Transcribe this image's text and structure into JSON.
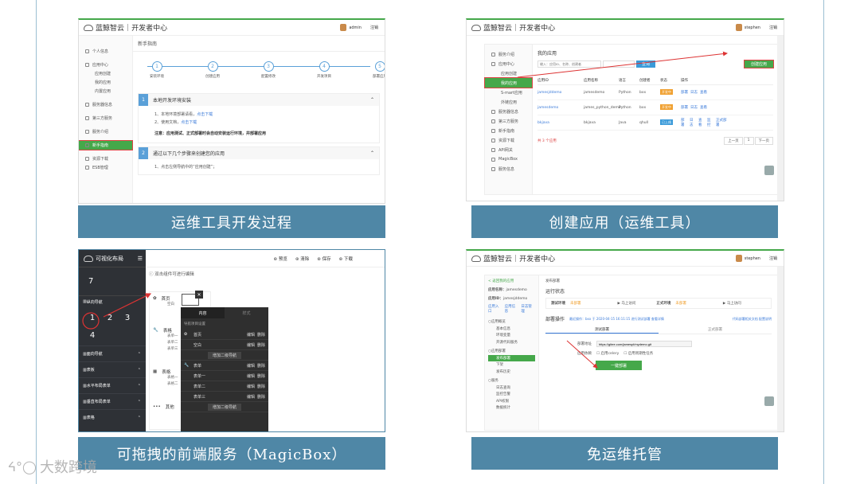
{
  "captions": [
    "运维工具开发过程",
    "创建应用（运维工具）",
    "可拖拽的前端服务（MagicBox）",
    "免运维托管"
  ],
  "watermark": "大数跨境",
  "common": {
    "brand": "蓝鲸智云",
    "center": "开发者中心",
    "logout": "注销"
  },
  "p1": {
    "user": "admin",
    "breadcrumb": "新手指南",
    "sidebar": [
      "个人信息",
      "应用中心",
      "应用创建",
      "我的应用",
      "内置应用",
      "服务器信息",
      "第三方服务",
      "服务介绍",
      "新手指南",
      "资源下载",
      "ESB管理"
    ],
    "steps": [
      {
        "n": "1",
        "label": "安装环境"
      },
      {
        "n": "2",
        "label": "创建应用"
      },
      {
        "n": "3",
        "label": "配置修改"
      },
      {
        "n": "4",
        "label": "开发项目"
      },
      {
        "n": "5",
        "label": "部署应用"
      }
    ],
    "sec1_title": "本地开发环境安装",
    "sec1_lines": [
      "1、本地环境部署请看，",
      "2、使用文档，"
    ],
    "sec1_links": [
      "点击下载",
      "点击下载"
    ],
    "sec1_note": "注意：应用测试、正式部署时会自动安装运行环境，并部署应用",
    "sec2_title": "通过以下几个步骤来创建您的应用",
    "sec2_line": "1、点击左侧导航中的“应用创建”；"
  },
  "p2": {
    "user": "stephen",
    "title": "我的应用",
    "search_placeholder": "输入：应用ID、名称、创建者",
    "search_btn": "查询",
    "create_btn": "创建应用",
    "sidebar": [
      "服务介绍",
      "应用中心",
      "应用创建",
      "我的应用",
      "S-mart应用",
      "外链应用",
      "服务器信息",
      "第三方服务",
      "新手指南",
      "资源下载",
      "API网关",
      "MagicBox",
      "服务信息"
    ],
    "columns": [
      "应用ID",
      "应用名称",
      "语言",
      "创建者",
      "状态",
      "操作"
    ],
    "rows": [
      {
        "id": "jamesjddemo",
        "name": "jamesdemo",
        "lang": "Python",
        "creator": "bxx",
        "status": "开发中",
        "ops": [
          "部署",
          "日志",
          "查看"
        ]
      },
      {
        "id": "jamesdemo",
        "name": "james_python_demo",
        "lang": "Python",
        "creator": "bxx",
        "status": "开发中",
        "ops": [
          "部署",
          "日志",
          "查看"
        ]
      },
      {
        "id": "bkjava",
        "name": "bkjava",
        "lang": "Java",
        "creator": "qhull",
        "status": "已上线",
        "ops": [
          "部署",
          "日志",
          "查看",
          "监控",
          "正式部署"
        ]
      }
    ],
    "footer": "共 3 个应用",
    "pager": [
      "上一页",
      "1",
      "下一页"
    ]
  },
  "p3": {
    "title": "可视化布局",
    "toolbar": [
      "预览",
      "清除",
      "保存",
      "下载"
    ],
    "hint": "双击组件可进行编辑",
    "grid": [
      "7",
      "1",
      "2",
      "3",
      "4"
    ],
    "left_sections": [
      "纵向导航",
      "面向导航",
      "表板",
      "水平布局表单",
      "垂直布局表单",
      "表格"
    ],
    "nav_items": [
      {
        "label": "首页",
        "subs": [
          "空白"
        ]
      },
      {
        "label": "表格",
        "subs": [
          "表单一",
          "表单二",
          "表单三"
        ]
      },
      {
        "label": "表格",
        "subs": [
          "表格一",
          "表格二"
        ]
      },
      {
        "label": "其他",
        "subs": []
      }
    ],
    "dialog_tabs": [
      "内容",
      "样式"
    ],
    "dialog_hint": "导航项目设置",
    "dialog_rows": [
      {
        "label": "首页",
        "ops": [
          "编辑",
          "删除"
        ]
      },
      {
        "label": "空白",
        "ops": [
          "编辑",
          "删除"
        ]
      },
      {
        "add": "增加二级导航"
      },
      {
        "label": "表单",
        "ops": [
          "编辑",
          "删除"
        ]
      },
      {
        "label": "表单一",
        "ops": [
          "编辑",
          "删除"
        ]
      },
      {
        "label": "表单二",
        "ops": [
          "编辑",
          "删除"
        ]
      },
      {
        "label": "表单三",
        "ops": [
          "编辑",
          "删除"
        ]
      },
      {
        "add": "增加二级导航"
      }
    ]
  },
  "p4": {
    "user": "stephen",
    "back": "< 返回我的应用",
    "app_name_label": "应用名称：",
    "app_name": "jamesdemo",
    "app_id_label": "应用ID：",
    "app_id": "jamesjddemo",
    "app_links": [
      "应用入口",
      "应用信息",
      "日志管理"
    ],
    "sidebar": [
      "应用概览",
      "基本信息",
      "环境变量",
      "开源代码服务",
      "应用部署",
      "发布部署",
      "下架",
      "发布历史",
      "服务",
      "日志查询",
      "监控告警",
      "API权限",
      "数据统计"
    ],
    "breadcrumb": "发布部署",
    "status_title": "运行状态",
    "test_env": "测试环境",
    "test_status": "未部署",
    "test_action": "马上访问",
    "prod_env": "正式环境",
    "prod_status": "未部署",
    "prod_action": "马上访问",
    "deploy_op": "部署操作",
    "deploy_info": "最近操作：bxx 于 2020-04-15 16:11:15 进行测试部署 查看详情",
    "deploy_right": "代码部署相关文档 配置说明",
    "tabs": [
      "测试部署",
      "正式部署"
    ],
    "repo_label": "部署地址",
    "repo": "https://gitee.com/jamespl/mydemo.git",
    "option_label": "应用依赖",
    "options": [
      "启用celery",
      "启用周期性任务"
    ],
    "deploy_btn": "一键部署",
    "status_url": "javascript:void(0)"
  }
}
